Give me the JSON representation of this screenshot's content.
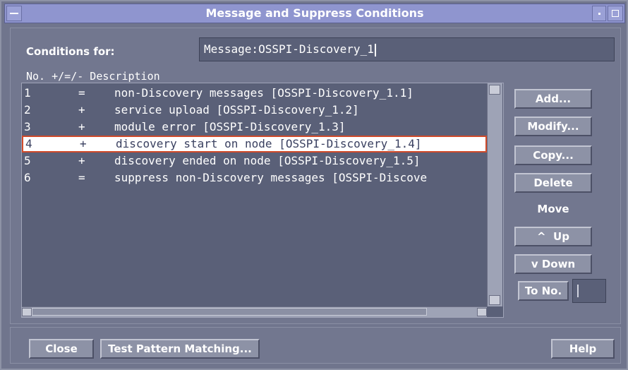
{
  "window": {
    "title": "Message and Suppress Conditions"
  },
  "conditions_for": {
    "label": "Conditions for:",
    "value": "Message:OSSPI-Discovery_1"
  },
  "list": {
    "header": "No. +/=/- Description",
    "rows": [
      {
        "no": "1",
        "op": "=",
        "desc": "non-Discovery messages [OSSPI-Discovery_1.1]",
        "selected": false
      },
      {
        "no": "2",
        "op": "+",
        "desc": "service upload [OSSPI-Discovery_1.2]",
        "selected": false
      },
      {
        "no": "3",
        "op": "+",
        "desc": "module error [OSSPI-Discovery_1.3]",
        "selected": false
      },
      {
        "no": "4",
        "op": "+",
        "desc": "discovery start on node [OSSPI-Discovery_1.4]",
        "selected": true
      },
      {
        "no": "5",
        "op": "+",
        "desc": "discovery ended on node [OSSPI-Discovery_1.5]",
        "selected": false
      },
      {
        "no": "6",
        "op": "=",
        "desc": "suppress non-Discovery messages [OSSPI-Discove",
        "selected": false
      }
    ]
  },
  "side_buttons": {
    "add": "Add...",
    "modify": "Modify...",
    "copy": "Copy...",
    "delete": "Delete",
    "move_label": "Move",
    "up": "^  Up",
    "down": "v Down",
    "to_no": "To No."
  },
  "bottom_buttons": {
    "close": "Close",
    "test": "Test Pattern Matching...",
    "help": "Help"
  }
}
